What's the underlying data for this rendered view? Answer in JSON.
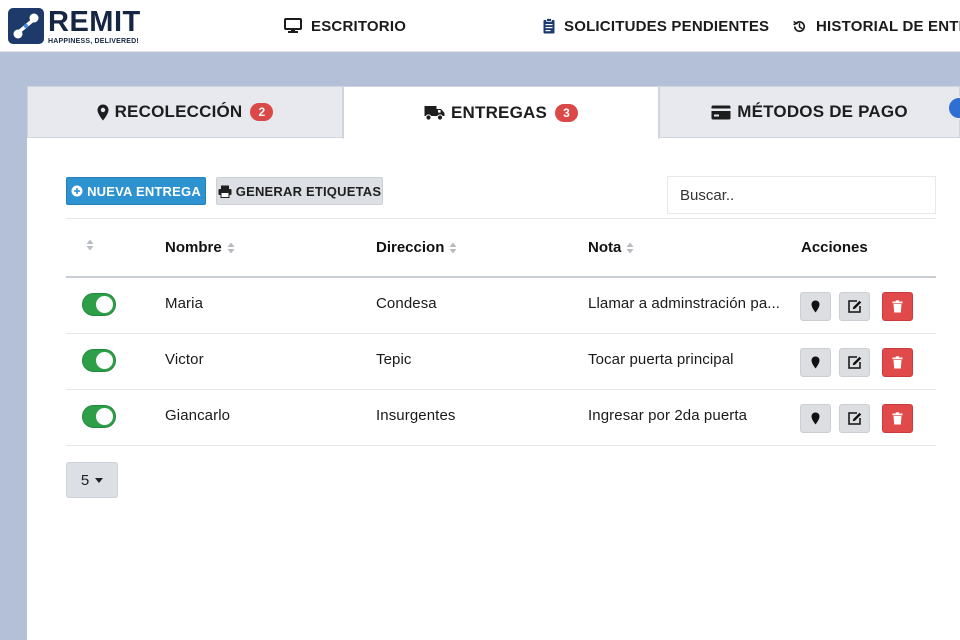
{
  "brand": {
    "name": "REMIT",
    "tagline": "HAPPINESS, DELIVERED!"
  },
  "nav": [
    {
      "label": "ESCRITORIO",
      "icon": "monitor-icon"
    },
    {
      "label": "SOLICITUDES PENDIENTES",
      "icon": "clipboard-icon"
    },
    {
      "label": "HISTORIAL DE ENTR",
      "icon": "history-icon"
    }
  ],
  "tabs": [
    {
      "label": "RECOLECCIÓN",
      "badge": "2",
      "icon": "map-marker-icon"
    },
    {
      "label": "ENTREGAS",
      "badge": "3",
      "icon": "truck-icon",
      "active": true
    },
    {
      "label": "MÉTODOS DE PAGO",
      "icon": "credit-card-icon"
    }
  ],
  "toolbar": {
    "new_label": "NUEVA ENTREGA",
    "labels_label": "GENERAR ETIQUETAS",
    "search_placeholder": "Buscar.."
  },
  "table": {
    "headers": {
      "nombre": "Nombre",
      "direccion": "Direccion",
      "nota": "Nota",
      "acciones": "Acciones"
    },
    "rows": [
      {
        "nombre": "Maria",
        "direccion": "Condesa",
        "nota": "Llamar a adminstración pa...",
        "active": true
      },
      {
        "nombre": "Victor",
        "direccion": "Tepic",
        "nota": "Tocar puerta principal",
        "active": true
      },
      {
        "nombre": "Giancarlo",
        "direccion": "Insurgentes",
        "nota": "Ingresar por 2da puerta",
        "active": true
      }
    ]
  },
  "pagination": {
    "page_size": "5"
  },
  "colors": {
    "primary": "#2d93d0",
    "toggle_on": "#2e9f48",
    "danger": "#e14a4a",
    "badge": "#db4848",
    "brand_dark": "#142642"
  }
}
